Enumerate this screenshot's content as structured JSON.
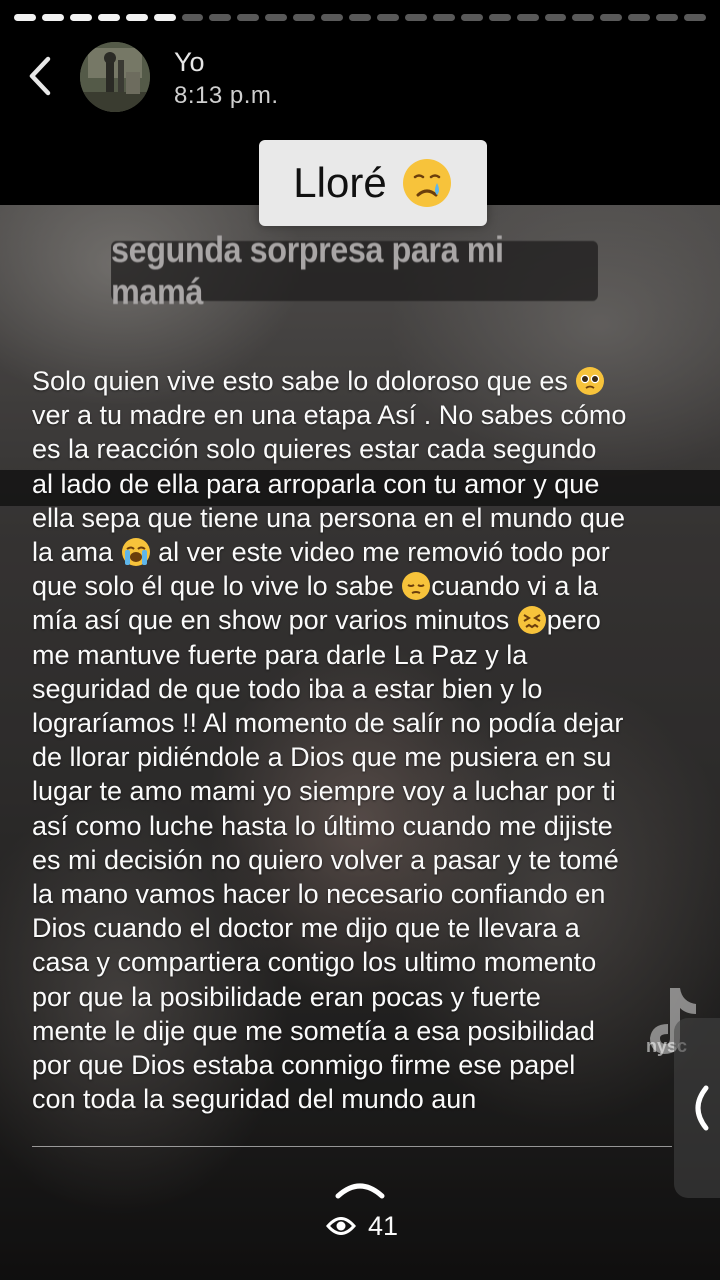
{
  "story": {
    "progress": {
      "total_segments": 25,
      "completed_segments": 6
    },
    "author": {
      "name": "Yo",
      "timestamp": "8:13 p.m."
    },
    "stickers": {
      "main_text": "Lloré",
      "main_emoji": "crying-face",
      "sub_text": "segunda sorpresa para mi mamá"
    },
    "caption": {
      "lines": [
        "Solo quien vive esto sabe lo doloroso que es",
        "ver a tu madre en una etapa Así . No sabes cómo",
        "es la reacción solo quieres estar cada segundo",
        "al lado de ella para arroparla con tu amor y que",
        "ella sepa que tiene una persona en el mundo que",
        "la ama",
        "al ver este video me removió todo por",
        "que solo él que lo vive lo sabe",
        "cuando vi a la",
        "mía así que en show por varios minutos",
        "pero",
        "me mantuve fuerte para darle La Paz y la",
        "seguridad de que todo iba a estar bien y lo",
        "lograríamos !! Al momento de salír no podía dejar",
        "de llorar pidiéndole a Dios que me pusiera en su",
        "lugar te amo mami yo siempre voy a luchar por ti",
        "así como luche hasta lo último cuando me dijiste",
        "es mi decisión no quiero volver a pasar y te tomé",
        "la mano vamos hacer lo necesario confiando en",
        "Dios cuando el doctor me dijo que te llevara a",
        "casa y compartiera contigo los ultimo momento",
        "por que la posibilidade eran pocas y fuerte",
        "mente le dije que me sometía a esa posibilidad",
        "por que Dios estaba conmigo firme ese papel",
        "con toda la seguridad del mundo aun"
      ],
      "emojis": [
        "pleading-face",
        "loudly-crying-face",
        "pensive-face",
        "confounded-face"
      ]
    },
    "watermark": {
      "text": "nysc"
    },
    "footer": {
      "view_count": "41"
    }
  }
}
